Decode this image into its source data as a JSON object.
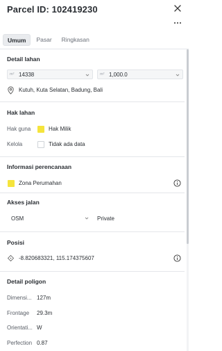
{
  "header": {
    "title": "Parcel ID: 102419230"
  },
  "tabs": [
    {
      "label": "Umum",
      "active": true
    },
    {
      "label": "Pasar",
      "active": false
    },
    {
      "label": "Ringkasan",
      "active": false
    }
  ],
  "detail_lahan": {
    "title": "Detail lahan",
    "area_field": {
      "unit": "m²",
      "value": "14338"
    },
    "second_field": {
      "unit": "m²",
      "value": "1,000.0"
    },
    "address": "Kutuh, Kuta Selatan, Badung, Bali"
  },
  "hak_lahan": {
    "title": "Hak lahan",
    "rows": [
      {
        "label": "Hak guna",
        "value": "Hak Milik",
        "swatch": "yellow"
      },
      {
        "label": "Kelola",
        "value": "Tidak ada data",
        "swatch": "empty"
      }
    ]
  },
  "perencanaan": {
    "title": "Informasi perencanaan",
    "zone": "Zona Perumahan",
    "zone_color": "#f5e43c"
  },
  "akses_jalan": {
    "title": "Akses jalan",
    "select_value": "OSM",
    "access_value": "Private"
  },
  "posisi": {
    "title": "Posisi",
    "coordinates": "-8.820683321, 115.174375607"
  },
  "detail_poligon": {
    "title": "Detail poligon",
    "rows": [
      {
        "label": "Dimensi...",
        "value": "127m"
      },
      {
        "label": "Frontage",
        "value": "29.3m"
      },
      {
        "label": "Orientati...",
        "value": "W"
      },
      {
        "label": "Perfection",
        "value": "0.87"
      }
    ]
  },
  "icons": {
    "close": "close-icon",
    "more": "more-icon",
    "location": "location-pin-icon",
    "info": "info-icon",
    "crosshair": "crosshair-icon",
    "chevron": "chevron-down-icon"
  }
}
